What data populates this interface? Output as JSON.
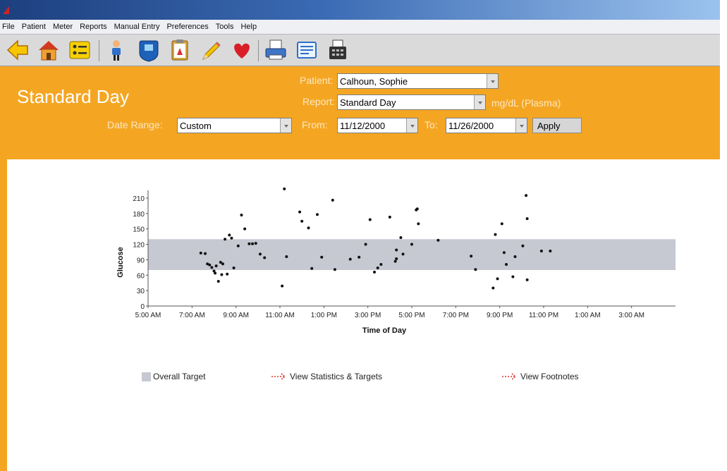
{
  "menu": [
    "File",
    "Patient",
    "Meter",
    "Reports",
    "Manual Entry",
    "Preferences",
    "Tools",
    "Help"
  ],
  "toolbar": {
    "icons": [
      "back-arrow-icon",
      "home-icon",
      "list-icon",
      "person-icon",
      "meter-icon",
      "clipboard-icon",
      "pencil-icon",
      "heart-icon",
      "printer-icon",
      "notebook-icon",
      "fax-icon"
    ]
  },
  "header": {
    "title": "Standard Day",
    "patient_label": "Patient:",
    "patient_value": "Calhoun, Sophie",
    "report_label": "Report:",
    "report_value": "Standard Day",
    "units": "mg/dL (Plasma)",
    "date_range_label": "Date Range:",
    "date_range_value": "Custom",
    "from_label": "From:",
    "from_value": "11/12/2000",
    "to_label": "To:",
    "to_value": "11/26/2000",
    "apply_label": "Apply"
  },
  "colors": {
    "header_bg": "#f4a623",
    "target_band": "#c6c9d2",
    "link_arrow": "#d9332b"
  },
  "chart_data": {
    "type": "scatter",
    "xlabel": "Time of Day",
    "ylabel": "Glucose",
    "x_ticks": [
      "5:00 AM",
      "7:00 AM",
      "9:00 AM",
      "11:00 AM",
      "1:00 PM",
      "3:00 PM",
      "5:00 PM",
      "7:00 PM",
      "9:00 PM",
      "11:00 PM",
      "1:00 AM",
      "3:00 AM"
    ],
    "y_ticks": [
      0,
      30,
      60,
      90,
      120,
      150,
      180,
      210
    ],
    "ylim": [
      0,
      225
    ],
    "xlim_hours": [
      5,
      29
    ],
    "target_range": [
      70,
      130
    ],
    "points_hours": [
      [
        7.4,
        103
      ],
      [
        7.6,
        102
      ],
      [
        7.7,
        82
      ],
      [
        7.8,
        80
      ],
      [
        7.9,
        75
      ],
      [
        8.0,
        68
      ],
      [
        8.05,
        64
      ],
      [
        8.1,
        78
      ],
      [
        8.2,
        48
      ],
      [
        8.3,
        85
      ],
      [
        8.35,
        61
      ],
      [
        8.4,
        82
      ],
      [
        8.5,
        130
      ],
      [
        8.6,
        62
      ],
      [
        8.7,
        138
      ],
      [
        8.8,
        132
      ],
      [
        8.9,
        74
      ],
      [
        9.1,
        117
      ],
      [
        9.25,
        177
      ],
      [
        9.4,
        150
      ],
      [
        9.6,
        121
      ],
      [
        9.75,
        121
      ],
      [
        9.9,
        122
      ],
      [
        10.1,
        101
      ],
      [
        10.3,
        94
      ],
      [
        11.1,
        39
      ],
      [
        11.2,
        228
      ],
      [
        11.3,
        96
      ],
      [
        11.9,
        183
      ],
      [
        12.0,
        165
      ],
      [
        12.3,
        152
      ],
      [
        12.45,
        73
      ],
      [
        12.7,
        178
      ],
      [
        12.9,
        95
      ],
      [
        13.4,
        206
      ],
      [
        13.5,
        71
      ],
      [
        14.2,
        91
      ],
      [
        14.6,
        95
      ],
      [
        14.9,
        120
      ],
      [
        15.1,
        168
      ],
      [
        15.3,
        66
      ],
      [
        15.45,
        74
      ],
      [
        15.6,
        81
      ],
      [
        16.0,
        173
      ],
      [
        16.25,
        87
      ],
      [
        16.3,
        92
      ],
      [
        16.3,
        109
      ],
      [
        16.5,
        133
      ],
      [
        16.6,
        101
      ],
      [
        17.0,
        120
      ],
      [
        17.2,
        187
      ],
      [
        17.25,
        189
      ],
      [
        17.3,
        160
      ],
      [
        18.2,
        128
      ],
      [
        19.7,
        97
      ],
      [
        19.9,
        71
      ],
      [
        20.7,
        35
      ],
      [
        20.8,
        139
      ],
      [
        20.9,
        53
      ],
      [
        21.1,
        160
      ],
      [
        21.2,
        104
      ],
      [
        21.3,
        81
      ],
      [
        21.6,
        57
      ],
      [
        21.7,
        96
      ],
      [
        22.05,
        117
      ],
      [
        22.2,
        215
      ],
      [
        22.25,
        170
      ],
      [
        22.25,
        51
      ],
      [
        22.9,
        107
      ],
      [
        23.3,
        107
      ]
    ],
    "legend": [
      "Overall Target"
    ]
  },
  "links": {
    "statistics": "View Statistics & Targets",
    "footnotes": "View Footnotes"
  }
}
